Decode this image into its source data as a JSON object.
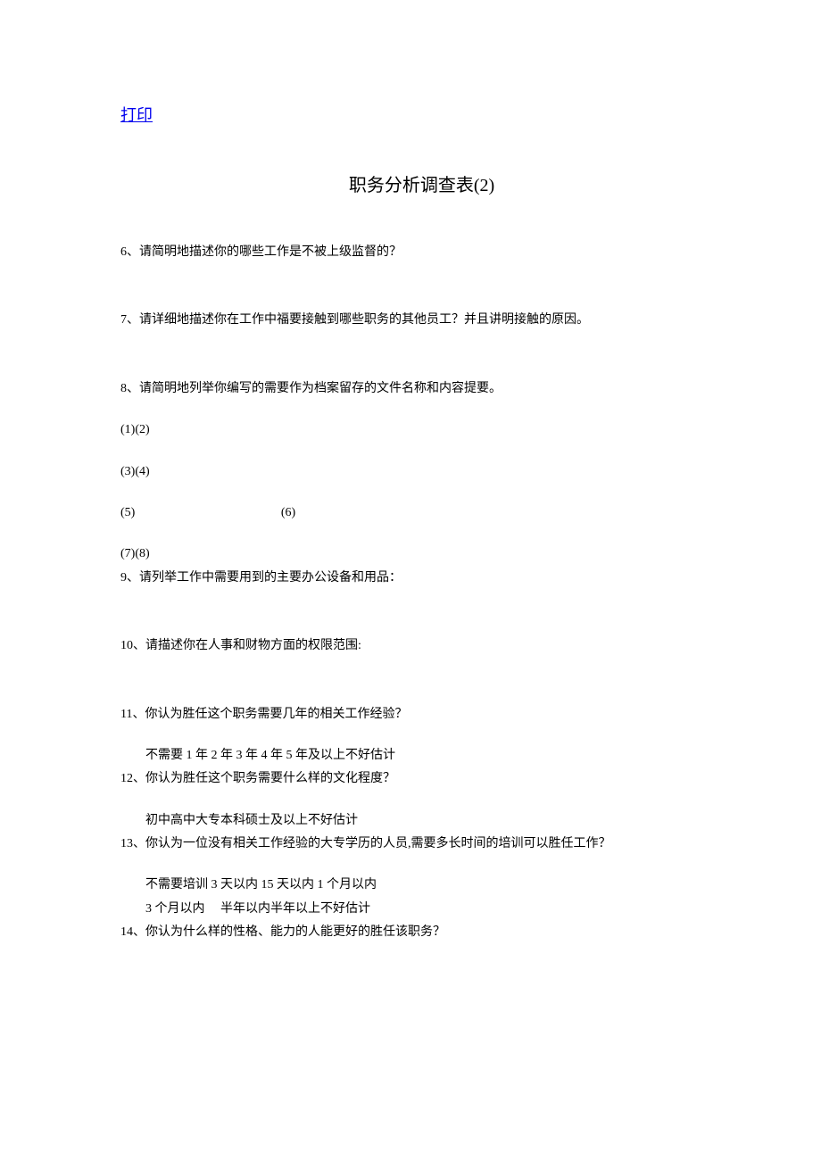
{
  "print_link": "打印",
  "title": "职务分析调查表(2)",
  "q6": "6、请简明地描述你的哪些工作是不被上级监督的？",
  "q7": "7、请详细地描述你在工作中福要接触到哪些职务的其他员工？并且讲明接触的原因。",
  "q8": "8、请简明地列举你编写的需要作为档案留存的文件名称和内容提要。",
  "blanks": {
    "row1": "(1)(2)",
    "row2": "(3)(4)",
    "row3_left": "(5)",
    "row3_right": "(6)",
    "row4": "(7)(8)"
  },
  "q9": "9、请列举工作中需要用到的主要办公设备和用品：",
  "q10": "10、请描述你在人事和财物方面的权限范围:",
  "q11": "11、你认为胜任这个职务需要几年的相关工作经验？",
  "q11_options": "不需要 1 年 2 年 3 年 4 年 5 年及以上不好估计",
  "q12": "12、你认为胜任这个职务需要什么样的文化程度？",
  "q12_options": "初中高中大专本科硕士及以上不好估计",
  "q13": "13、你认为一位没有相关工作经验的大专学历的人员,需要多长时间的培训可以胜任工作？",
  "q13_options_line1": "不需要培训 3 天以内 15 天以内 1 个月以内",
  "q13_options_line2": "3 个月以内　 半年以内半年以上不好估计",
  "q14": "14、你认为什么样的性格、能力的人能更好的胜任该职务？"
}
